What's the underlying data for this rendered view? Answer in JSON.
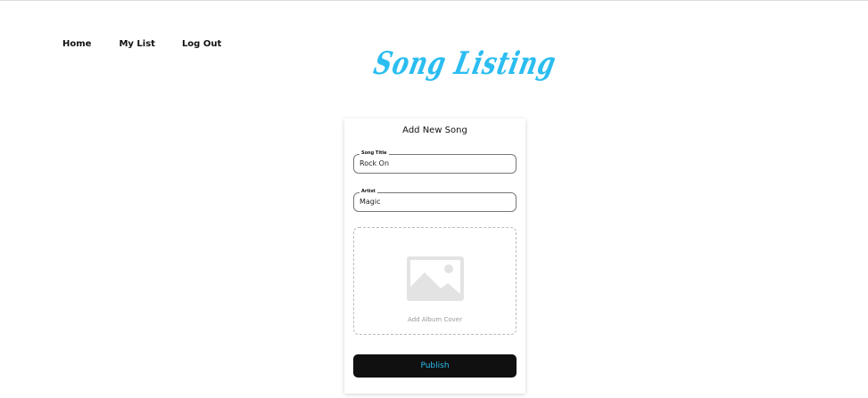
{
  "nav": {
    "home": "Home",
    "my_list": "My List",
    "log_out": "Log Out"
  },
  "logo": {
    "text": "Song Listing",
    "color": "#2bbdf0"
  },
  "form": {
    "title": "Add New Song",
    "song_title": {
      "label": "Song Title",
      "value": "Rock On"
    },
    "artist": {
      "label": "Artist",
      "value": "Magic"
    },
    "album_cover": {
      "label": "Add Album Cover",
      "icon": "image-placeholder-icon"
    },
    "publish_label": "Publish",
    "publish_bg": "#101010",
    "publish_text_color": "#2bbdf0"
  }
}
